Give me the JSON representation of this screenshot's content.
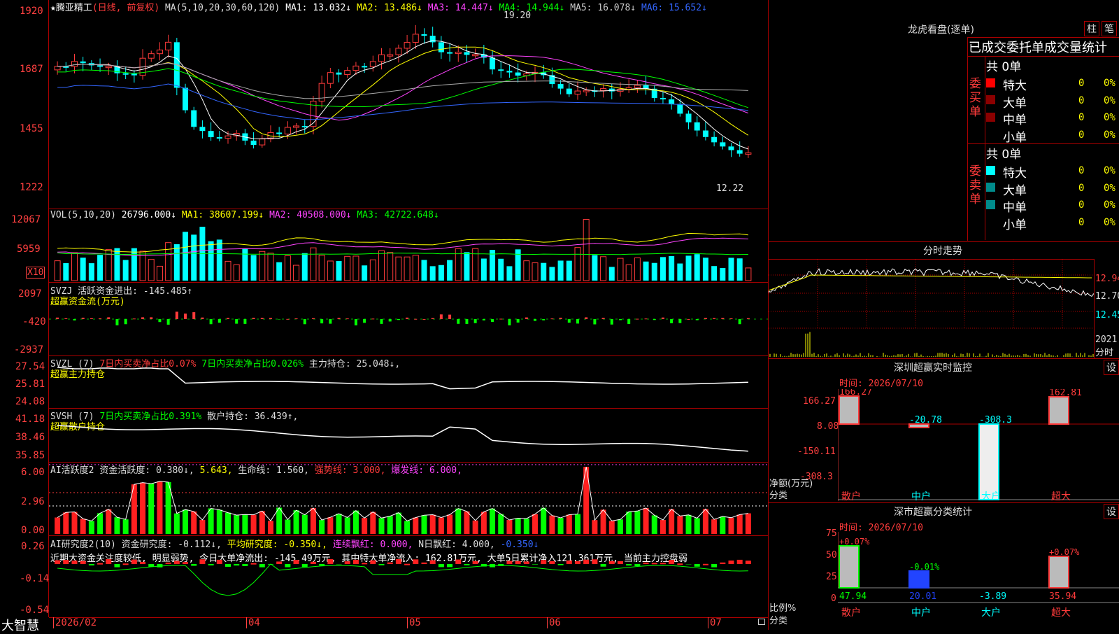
{
  "header": {
    "star": "★",
    "stock_name": "腾亚精工",
    "period": "(日线, 前复权)",
    "ma_label": "MA(5,10,20,30,60,120)",
    "ma1": "MA1: 13.032↓",
    "ma2": "MA2: 13.486↓",
    "ma3": "MA3: 14.447↓",
    "ma4": "MA4: 14.944↓",
    "ma5": "MA5: 16.078↓",
    "ma6": "MA6: 15.652↓",
    "peak_label": "19.20",
    "low_label": "12.22"
  },
  "price_axis": [
    "1920",
    "1687",
    "1455",
    "1222"
  ],
  "vol": {
    "label": "VOL(5,10,20)",
    "value": "26796.000↓",
    "ma1": "MA1: 38607.199↓",
    "ma2": "MA2: 40508.000↓",
    "ma3": "MA3: 42722.648↓",
    "axis": [
      "12067",
      "5959"
    ],
    "unit": "X10"
  },
  "svzj": {
    "label": "SVZJ  活跃资金进出: -145.485↑",
    "sub": "超赢资金流(万元)",
    "axis": [
      "2097",
      "-420",
      "-2937"
    ]
  },
  "svzl": {
    "label": "SVZL (7)",
    "t1": "7日内买卖净占比0.07%",
    "t2": "7日内买卖净占比0.026%",
    "t3": "主力持仓: 25.048↓,",
    "sub": "超赢主力持仓",
    "axis": [
      "27.54",
      "25.81",
      "24.08"
    ]
  },
  "svsh": {
    "label": "SVSH (7)",
    "t1": "7日内买卖净占比0.391%",
    "t2": "散户持仓: 36.439↑,",
    "sub": "超赢散户持仓",
    "axis": [
      "41.18",
      "38.46",
      "35.85"
    ]
  },
  "ai1": {
    "label": "AI活跃度2",
    "t1": "资金活跃度: 0.380↓,",
    "t2": "5.643,",
    "t3": "生命线: 1.560,",
    "t4": "强势线: 3.000,",
    "t5": "爆发线: 6.000,",
    "axis": [
      "6.00",
      "2.96",
      "0.00"
    ]
  },
  "ai2": {
    "label": "AI研究度2(10)",
    "t1": "资金研究度: -0.112↓,",
    "t2": "平均研究度: -0.350↓,",
    "t3": "连续飘红: 0.000,",
    "t4": "N日飘红: 4.000,",
    "t5": "-0.350↓",
    "desc": "近期大资金关注度较低, 明显弱势, 今日大单净流出: -145.49万元, 其中特大单净流入: 162.81万元, 大单5日累计净入121.361万元, 当前主力控盘弱",
    "axis": [
      "0.26",
      "-0.14",
      "-0.54"
    ]
  },
  "dates": [
    "2026/02",
    "04",
    "05",
    "06",
    "07"
  ],
  "brand": "大智慧",
  "longhu": {
    "title": "龙虎看盘(逐单)",
    "btn_zhu": "柱",
    "btn_bi": "笔",
    "heading": "已成交委托单成交量统计",
    "buy_total": "共 0单",
    "sell_total": "共 0单",
    "buy_side": "委买单",
    "sell_side": "委卖单",
    "rows": [
      "特大",
      "大单",
      "中单",
      "小单"
    ],
    "value": "0",
    "pct": "0%",
    "colors": {
      "buy_big": "#ff0000",
      "buy_mid": "#8b0000",
      "sell_big": "#00ffff",
      "sell_mid": "#008b8b"
    }
  },
  "fenshi": {
    "title": "分时走势",
    "axis": [
      "12.94",
      "12.70",
      "12.45"
    ],
    "vol_label": "2021",
    "unit": "分时"
  },
  "monitor": {
    "title": "深圳超赢实时监控",
    "btn": "设",
    "time": "时间: 2026/07/10",
    "axis": [
      "166.27",
      "8.08",
      "-150.11",
      "-308.3"
    ],
    "unit": "净额(万元)",
    "cat_label": "分类",
    "values": [
      "166.27",
      "-20.78",
      "-308.3",
      "162.81"
    ],
    "categories": [
      "散户",
      "中户",
      "大户",
      "超大"
    ]
  },
  "classify": {
    "title": "深市超赢分类统计",
    "btn": "设",
    "time": "时间: 2026/07/10",
    "axis": [
      "75",
      "50",
      "25",
      "0"
    ],
    "unit": "比例%",
    "cat_label": "分类",
    "top_labels": [
      "+0.07%",
      "-0.01%",
      "+0.07%"
    ],
    "bottom_values": [
      "47.94",
      "20.01",
      "-3.89",
      "35.94"
    ],
    "categories": [
      "散户",
      "中户",
      "大户",
      "超大"
    ]
  }
}
